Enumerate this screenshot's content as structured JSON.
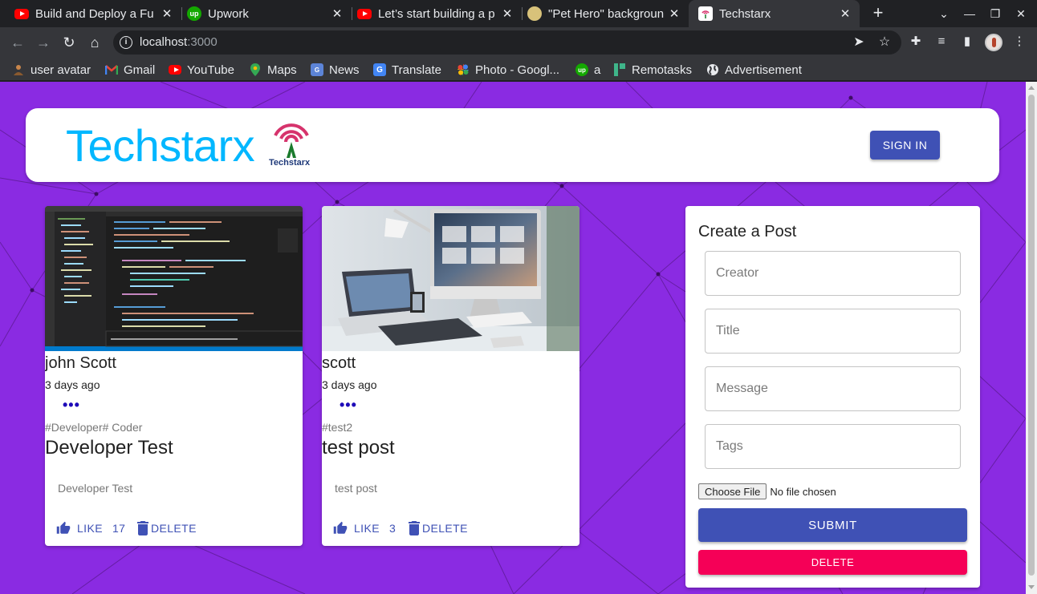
{
  "browser": {
    "tabs": [
      {
        "title": "Build and Deploy a Fu",
        "icon": "youtube-icon"
      },
      {
        "title": "Upwork",
        "icon": "upwork-icon"
      },
      {
        "title": "Let’s start building a p",
        "icon": "youtube-icon"
      },
      {
        "title": "\"Pet Hero\" backgroun",
        "icon": "pet-hero-icon"
      },
      {
        "title": "Techstarx",
        "icon": "techstarx-icon",
        "active": true
      }
    ],
    "new_tab": "+",
    "address": {
      "host": "localhost",
      "port": ":3000"
    },
    "bookmarks": [
      {
        "label": "user avatar",
        "icon": "avatar-icon"
      },
      {
        "label": "Gmail",
        "icon": "gmail-icon"
      },
      {
        "label": "YouTube",
        "icon": "youtube-icon"
      },
      {
        "label": "Maps",
        "icon": "maps-icon"
      },
      {
        "label": "News",
        "icon": "news-icon"
      },
      {
        "label": "Translate",
        "icon": "translate-icon"
      },
      {
        "label": "Photo - Googl...",
        "icon": "photos-icon"
      },
      {
        "label": "a",
        "icon": "upwork-icon"
      },
      {
        "label": "Remotasks",
        "icon": "remotasks-icon"
      },
      {
        "label": "Advertisement",
        "icon": "globe-icon"
      }
    ]
  },
  "app": {
    "brand": "Techstarx",
    "brand_small": "Techstarx",
    "sign_in": "SIGN IN",
    "colors": {
      "background": "#8a2be2",
      "primary": "#3f51b5",
      "secondary": "#f50057",
      "brand": "#00b7ff"
    }
  },
  "posts": [
    {
      "creator": "john Scott",
      "time": "3 days ago",
      "more": "•••",
      "tags": "#Developer# Coder",
      "title": "Developer Test",
      "message": "Developer Test",
      "like_label": "LIKE",
      "like_count": "17",
      "delete_label": "DELETE"
    },
    {
      "creator": "scott",
      "time": "3 days ago",
      "more": "•••",
      "tags": "#test2",
      "title": "test post",
      "message": "test post",
      "like_label": "LIKE",
      "like_count": "3",
      "delete_label": "DELETE"
    }
  ],
  "form": {
    "title": "Create a Post",
    "creator_placeholder": "Creator",
    "title_placeholder": "Title",
    "message_placeholder": "Message",
    "tags_placeholder": "Tags",
    "choose_file": "Choose File",
    "file_status": "No file chosen",
    "submit": "SUBMIT",
    "clear": "DELETE"
  }
}
